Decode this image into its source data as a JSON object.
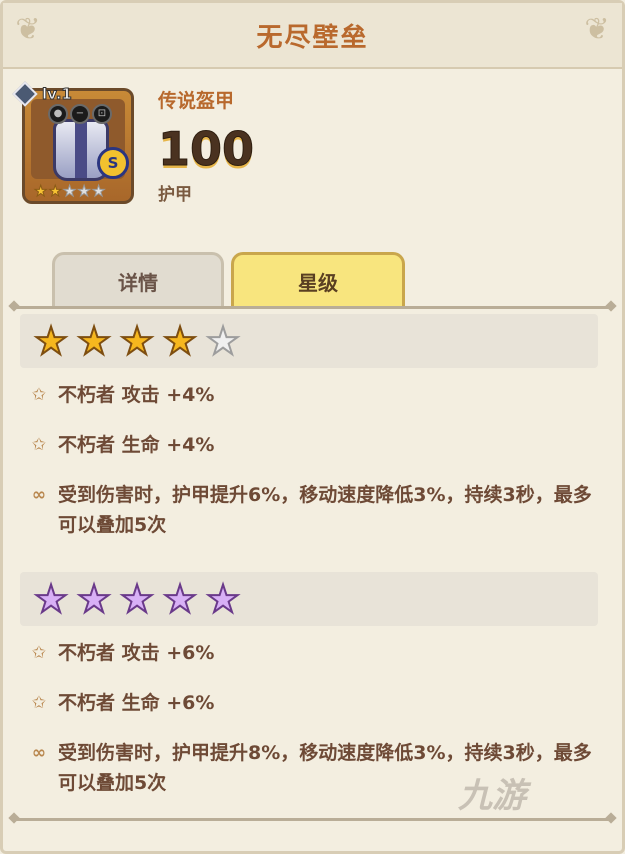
{
  "header": {
    "title": "无尽壁垒"
  },
  "item": {
    "level": "lv.1",
    "rarity": "传说盔甲",
    "value": "100",
    "stat_name": "护甲",
    "coin_letter": "S",
    "mini_stars_filled": 2,
    "mini_stars_total": 5
  },
  "tabs": [
    {
      "label": "详情",
      "active": false
    },
    {
      "label": "星级",
      "active": true
    }
  ],
  "tiers": [
    {
      "star_type": "gold",
      "stars_filled": 4,
      "stars_total": 5,
      "bonuses": [
        {
          "icon": "star-outline-icon",
          "text": "不朽者 攻击 +4%"
        },
        {
          "icon": "star-outline-icon",
          "text": "不朽者 生命 +4%"
        },
        {
          "icon": "loop-icon",
          "text": "受到伤害时，护甲提升6%，移动速度降低3%，持续3秒，最多可以叠加5次"
        }
      ]
    },
    {
      "star_type": "rainbow",
      "stars_filled": 5,
      "stars_total": 5,
      "bonuses": [
        {
          "icon": "star-outline-icon",
          "text": "不朽者 攻击 +6%"
        },
        {
          "icon": "star-outline-icon",
          "text": "不朽者 生命 +6%"
        },
        {
          "icon": "loop-icon",
          "text": "受到伤害时，护甲提升8%，移动速度降低3%，持续3秒，最多可以叠加5次"
        }
      ]
    }
  ],
  "watermark": "九游"
}
